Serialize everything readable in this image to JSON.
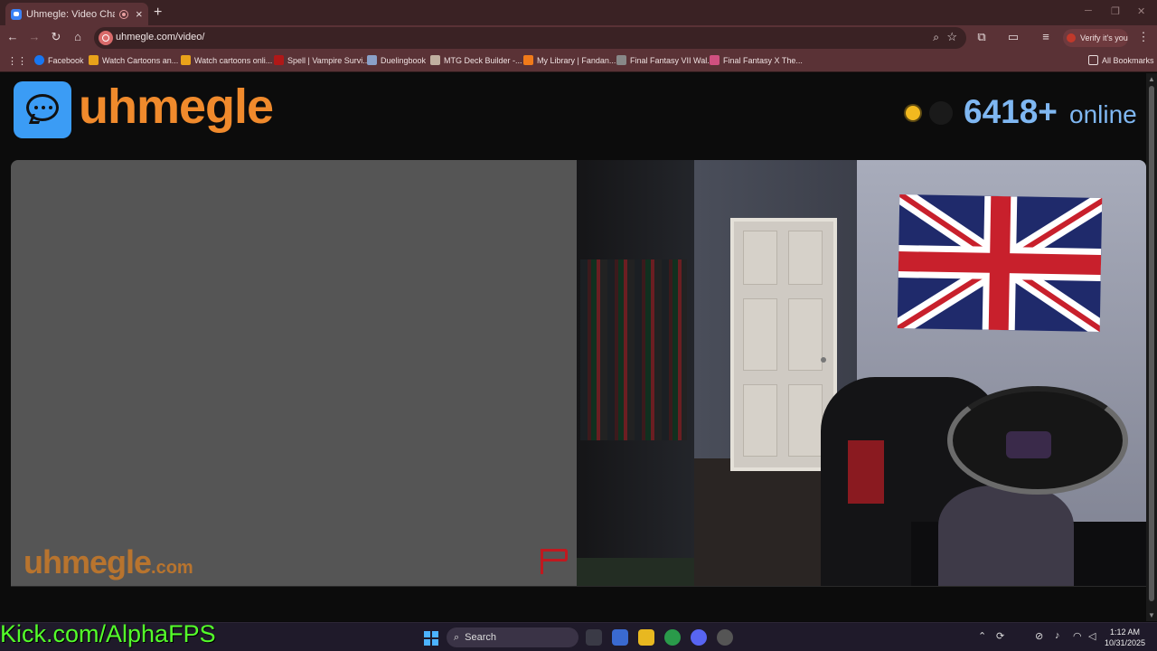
{
  "browser": {
    "tab_title": "Uhmegle: Video Chat | Rand",
    "url": "uhmegle.com/video/",
    "verify_label": "Verify it's you",
    "bookmarks": [
      {
        "label": "Facebook",
        "color": "#1877f2"
      },
      {
        "label": "Watch Cartoons an...",
        "color": "#e8a21a"
      },
      {
        "label": "Watch cartoons onli...",
        "color": "#e8a21a"
      },
      {
        "label": "Spell | Vampire Survi...",
        "color": "#b01818"
      },
      {
        "label": "Duelingbook",
        "color": "#8aa0c8"
      },
      {
        "label": "MTG Deck Builder -...",
        "color": "#c0b0a0"
      },
      {
        "label": "My Library | Fandan...",
        "color": "#f07a1a"
      },
      {
        "label": "Final Fantasy VII Wal...",
        "color": "#888888"
      },
      {
        "label": "Final Fantasy X The...",
        "color": "#d05080"
      }
    ],
    "all_bookmarks_label": "All Bookmarks"
  },
  "site": {
    "logo_text": "uhmegle",
    "online_count": "6418+",
    "online_label": "online",
    "watermark": "uhmegle",
    "watermark_suffix": ".com",
    "brand_color": "#f08a2c",
    "accent_blue": "#3b9cf5"
  },
  "overlay": {
    "stream_text": "Kick.com/AlphaFPS"
  },
  "taskbar": {
    "search_label": "Search",
    "time": "1:12 AM",
    "date": "10/31/2025"
  }
}
